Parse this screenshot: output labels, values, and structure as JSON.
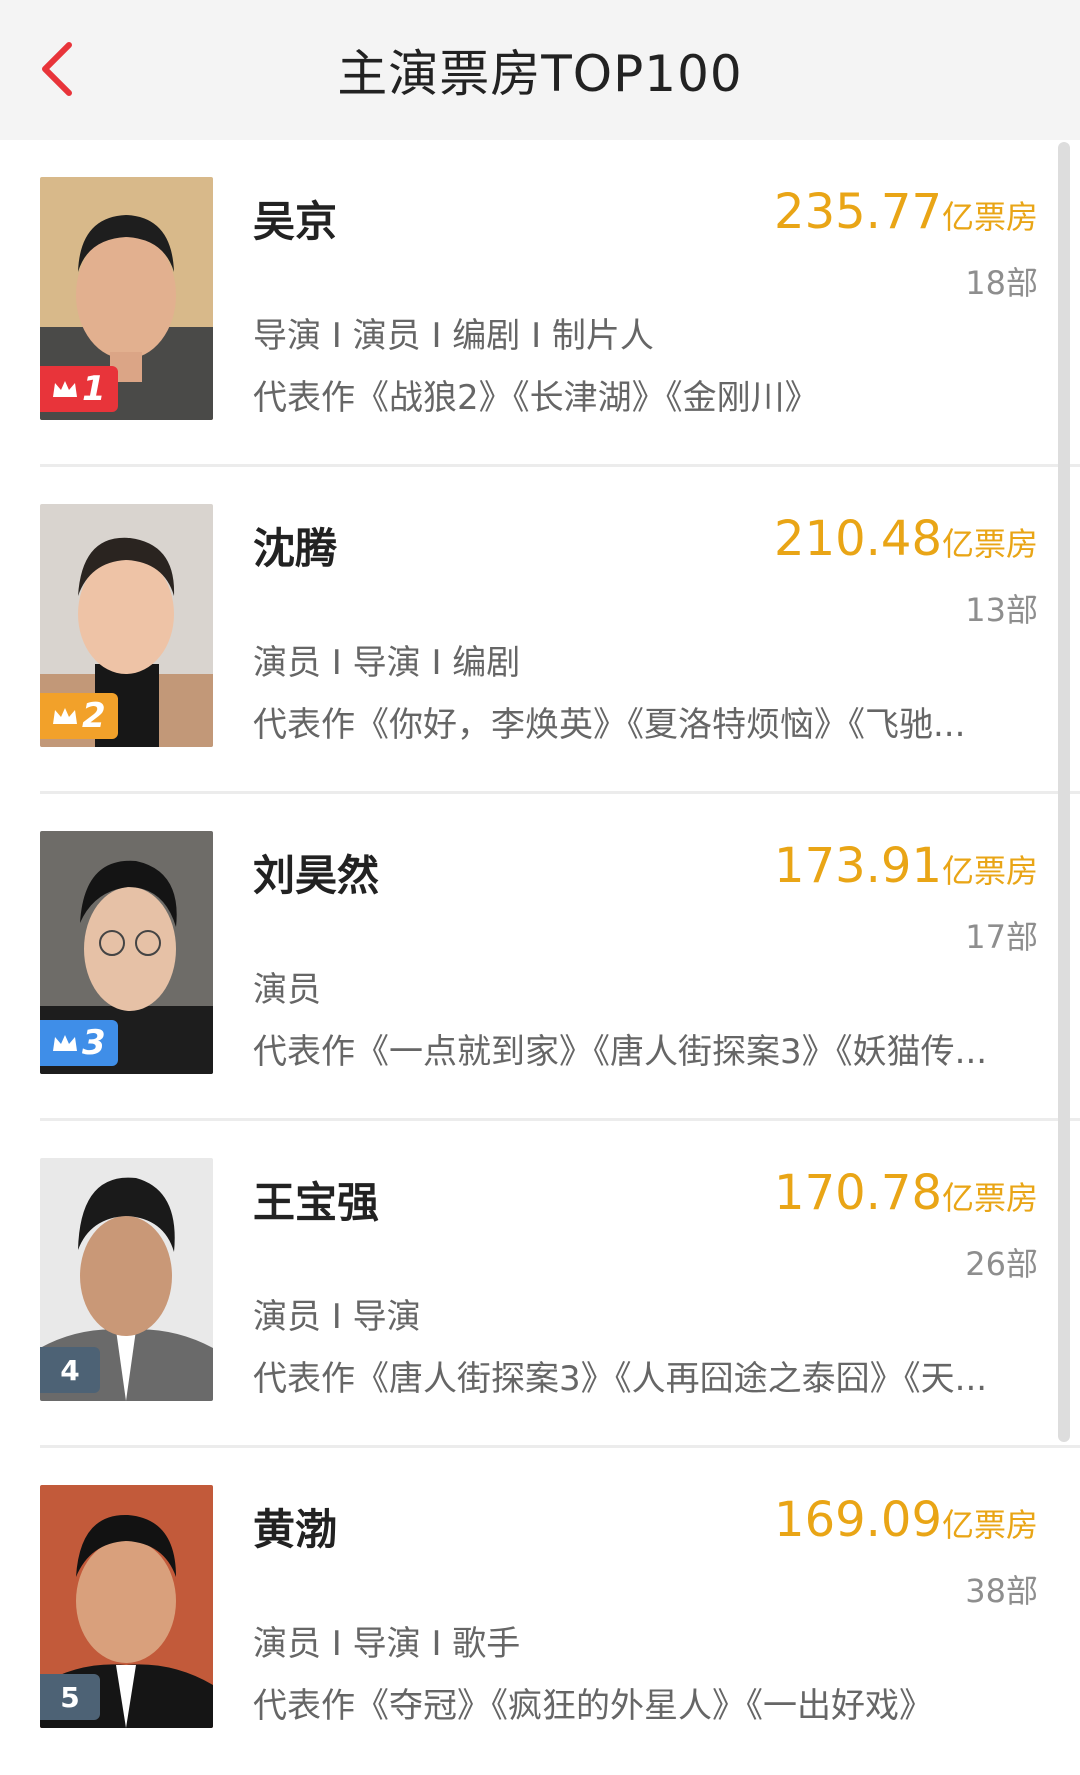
{
  "header": {
    "title": "主演票房TOP100",
    "back_icon": "chevron-left-icon",
    "accent": "#e8343a"
  },
  "colors": {
    "box_office": "#e9a516",
    "rank1": "#e8343a",
    "rank2": "#f2a12a",
    "rank3": "#3f8ee8",
    "rank_other": "#4d6275"
  },
  "list": [
    {
      "rank": "1",
      "name": "吴京",
      "box_office": "235.77",
      "unit": "亿票房",
      "films": "18部",
      "roles": "导演 I 演员 I 编剧 I 制片人",
      "works": "代表作《战狼2》《长津湖》《金刚川》",
      "badge": "crown-red"
    },
    {
      "rank": "2",
      "name": "沈腾",
      "box_office": "210.48",
      "unit": "亿票房",
      "films": "13部",
      "roles": "演员 I 导演 I 编剧",
      "works": "代表作《你好，李焕英》《夏洛特烦恼》《飞驰...",
      "badge": "crown-orange"
    },
    {
      "rank": "3",
      "name": "刘昊然",
      "box_office": "173.91",
      "unit": "亿票房",
      "films": "17部",
      "roles": "演员",
      "works": "代表作《一点就到家》《唐人街探案3》《妖猫传...",
      "badge": "crown-blue"
    },
    {
      "rank": "4",
      "name": "王宝强",
      "box_office": "170.78",
      "unit": "亿票房",
      "films": "26部",
      "roles": "演员 I 导演",
      "works": "代表作《唐人街探案3》《人再囧途之泰囧》《天...",
      "badge": "plain"
    },
    {
      "rank": "5",
      "name": "黄渤",
      "box_office": "169.09",
      "unit": "亿票房",
      "films": "38部",
      "roles": "演员 I 导演 I 歌手",
      "works": "代表作《夺冠》《疯狂的外星人》《一出好戏》",
      "badge": "plain"
    }
  ]
}
